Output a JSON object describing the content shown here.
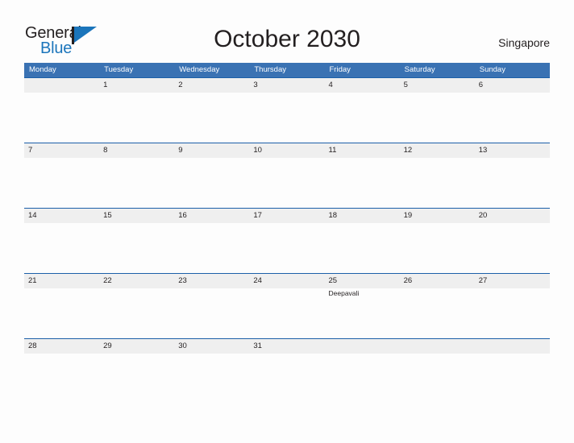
{
  "brand": {
    "name_part1": "General",
    "name_part2": "Blue",
    "flag_color": "#1b75bb"
  },
  "header": {
    "title": "October 2030",
    "location": "Singapore"
  },
  "calendar": {
    "month": "October",
    "year": "2030",
    "accent_color": "#3a72b3",
    "band_color": "#efefef",
    "rule_color": "#1b5fa8",
    "weekdays": [
      "Monday",
      "Tuesday",
      "Wednesday",
      "Thursday",
      "Friday",
      "Saturday",
      "Sunday"
    ],
    "weeks": [
      [
        {
          "day": "",
          "event": ""
        },
        {
          "day": "1",
          "event": ""
        },
        {
          "day": "2",
          "event": ""
        },
        {
          "day": "3",
          "event": ""
        },
        {
          "day": "4",
          "event": ""
        },
        {
          "day": "5",
          "event": ""
        },
        {
          "day": "6",
          "event": ""
        }
      ],
      [
        {
          "day": "7",
          "event": ""
        },
        {
          "day": "8",
          "event": ""
        },
        {
          "day": "9",
          "event": ""
        },
        {
          "day": "10",
          "event": ""
        },
        {
          "day": "11",
          "event": ""
        },
        {
          "day": "12",
          "event": ""
        },
        {
          "day": "13",
          "event": ""
        }
      ],
      [
        {
          "day": "14",
          "event": ""
        },
        {
          "day": "15",
          "event": ""
        },
        {
          "day": "16",
          "event": ""
        },
        {
          "day": "17",
          "event": ""
        },
        {
          "day": "18",
          "event": ""
        },
        {
          "day": "19",
          "event": ""
        },
        {
          "day": "20",
          "event": ""
        }
      ],
      [
        {
          "day": "21",
          "event": ""
        },
        {
          "day": "22",
          "event": ""
        },
        {
          "day": "23",
          "event": ""
        },
        {
          "day": "24",
          "event": ""
        },
        {
          "day": "25",
          "event": "Deepavali"
        },
        {
          "day": "26",
          "event": ""
        },
        {
          "day": "27",
          "event": ""
        }
      ],
      [
        {
          "day": "28",
          "event": ""
        },
        {
          "day": "29",
          "event": ""
        },
        {
          "day": "30",
          "event": ""
        },
        {
          "day": "31",
          "event": ""
        },
        {
          "day": "",
          "event": ""
        },
        {
          "day": "",
          "event": ""
        },
        {
          "day": "",
          "event": ""
        }
      ]
    ]
  }
}
